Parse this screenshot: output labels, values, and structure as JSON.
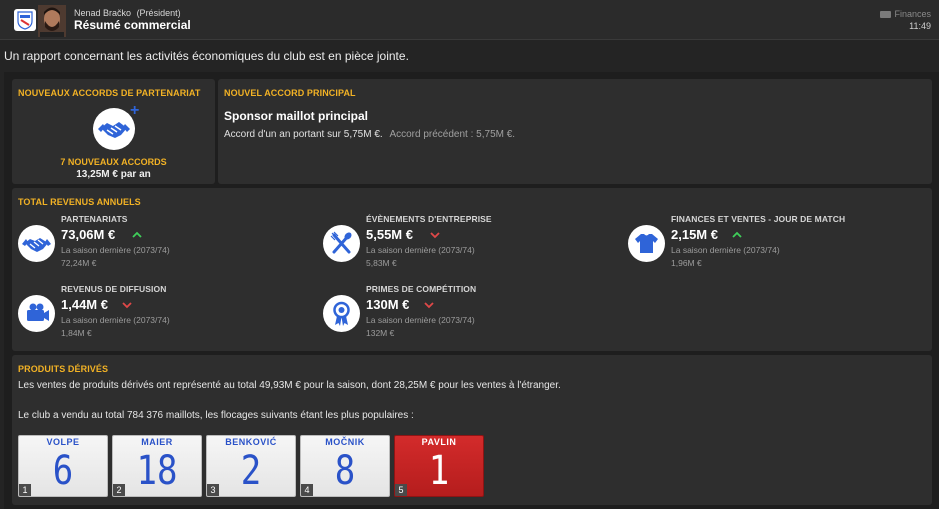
{
  "header": {
    "sender_name": "Nenad Bračko",
    "sender_role": "(Président)",
    "subject": "Résumé commercial",
    "tag": "Finances",
    "time": "11:49"
  },
  "intro": "Un rapport concernant les activités économiques du club est en pièce jointe.",
  "new_partnerships": {
    "title": "NOUVEAUX ACCORDS DE PARTENARIAT",
    "icon": "handshake-icon",
    "count": "7 NOUVEAUX ACCORDS",
    "amount": "13,25M € par an"
  },
  "main_deal": {
    "title": "NOUVEL ACCORD PRINCIPAL",
    "sponsor_title": "Sponsor maillot principal",
    "description": "Accord d'un an portant sur 5,75M €.",
    "previous": "Accord précédent : 5,75M €."
  },
  "revenue": {
    "title": "TOTAL REVENUS ANNUELS",
    "items": [
      {
        "label": "PARTENARIATS",
        "value": "73,06M €",
        "trend": "up",
        "season": "La saison dernière (2073/74)",
        "previous": "72,24M €",
        "icon": "handshake-icon"
      },
      {
        "label": "ÉVÈNEMENTS D'ENTREPRISE",
        "value": "5,55M €",
        "trend": "down",
        "season": "La saison dernière (2073/74)",
        "previous": "5,83M €",
        "icon": "cutlery-icon"
      },
      {
        "label": "FINANCES ET VENTES - JOUR DE MATCH",
        "value": "2,15M €",
        "trend": "up",
        "season": "La saison dernière (2073/74)",
        "previous": "1,96M €",
        "icon": "shirt-icon"
      },
      {
        "label": "REVENUS DE DIFFUSION",
        "value": "1,44M €",
        "trend": "down",
        "season": "La saison dernière (2073/74)",
        "previous": "1,84M €",
        "icon": "camera-icon"
      },
      {
        "label": "PRIMES DE COMPÉTITION",
        "value": "130M €",
        "trend": "down",
        "season": "La saison dernière (2073/74)",
        "previous": "132M €",
        "icon": "medal-icon"
      }
    ]
  },
  "merch": {
    "title": "PRODUITS DÉRIVÉS",
    "text1": "Les ventes de produits dérivés ont représenté au total 49,93M € pour la saison, dont 28,25M € pour les ventes à l'étranger.",
    "text2": "Le club a vendu au total 784 376 maillots, les flocages suivants étant les plus populaires :",
    "shirts": [
      {
        "name": "VOLPE",
        "number": "6",
        "rank": "1",
        "color": "white"
      },
      {
        "name": "MAIER",
        "number": "18",
        "rank": "2",
        "color": "white"
      },
      {
        "name": "BENKOVIĆ",
        "number": "2",
        "rank": "3",
        "color": "white"
      },
      {
        "name": "MOČNIK",
        "number": "8",
        "rank": "4",
        "color": "white"
      },
      {
        "name": "PAVLIN",
        "number": "1",
        "rank": "5",
        "color": "red"
      }
    ]
  },
  "colors": {
    "accent": "#f2b225",
    "up": "#3fcf5a",
    "down": "#e04848",
    "icon_blue": "#2f64d8"
  }
}
